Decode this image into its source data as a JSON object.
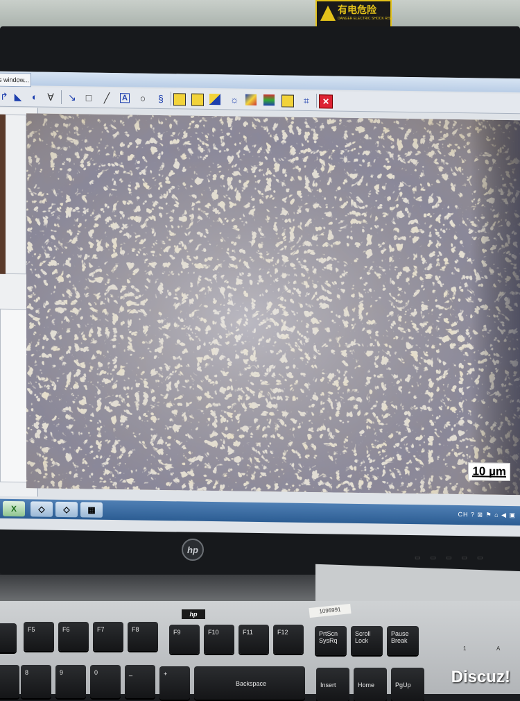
{
  "sign": {
    "title": "有电危险",
    "subtitle": "DANGER ELECTRIC SHOCK RISK"
  },
  "window": {
    "tab_label": "s window..."
  },
  "toolbar": {
    "icons": [
      "arrow-icon",
      "polygon-icon",
      "circle-g-icon",
      "angle-icon",
      "select-arrow-icon",
      "rectangle-icon",
      "line-icon",
      "text-a-icon",
      "ellipse-icon",
      "spiral-icon",
      "white-balance-icon",
      "histogram-icon",
      "contrast-icon",
      "brightness-icon",
      "color-balance-icon",
      "layers-icon",
      "image-adjust-icon",
      "crop-icon",
      "close-icon"
    ],
    "text_a": "A"
  },
  "image": {
    "scale_label": "10 µm"
  },
  "taskbar": {
    "excel_label": "X",
    "tray_text": "CH ?  ⊠ ⚑ ⌂ ◀ ▣"
  },
  "monitor": {
    "logo": "hp"
  },
  "keyboard": {
    "logo": "hp",
    "tag": "1095991",
    "fkeys": [
      "F5",
      "F6",
      "F7",
      "F8",
      "F9",
      "F10",
      "F11",
      "F12"
    ],
    "special": [
      "PrtScn SysRq",
      "Scroll Lock",
      "Pause Break"
    ],
    "numbers": [
      "8",
      "9",
      "0",
      "_",
      "+",
      "Backspace",
      "Insert",
      "Home",
      "PgUp"
    ],
    "leds": [
      "1",
      "A"
    ]
  },
  "watermark": "Discuz!"
}
